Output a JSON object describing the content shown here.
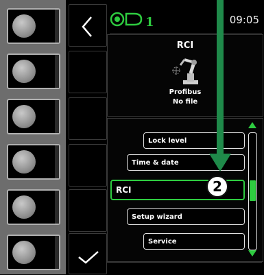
{
  "status": {
    "robot_number": "1",
    "time": "09:05"
  },
  "info_panel": {
    "title": "RCI",
    "line1": "Profibus",
    "line2": "No file"
  },
  "menu": {
    "items": [
      {
        "label": "Lock level"
      },
      {
        "label": "Time & date"
      },
      {
        "label": "RCI"
      },
      {
        "label": "Setup wizard"
      },
      {
        "label": "Service"
      }
    ],
    "selected_index": 2
  },
  "scroll": {
    "position_fraction": 0.5
  },
  "annotation": {
    "badge": "2"
  },
  "colors": {
    "accent": "#2ecc40",
    "annotation": "#1f8a4a"
  },
  "icons": {
    "back": "chevron-left-icon",
    "confirm": "checkmark-icon",
    "robot": "robot-arm-icon",
    "status_robot": "robot-status-icon"
  }
}
